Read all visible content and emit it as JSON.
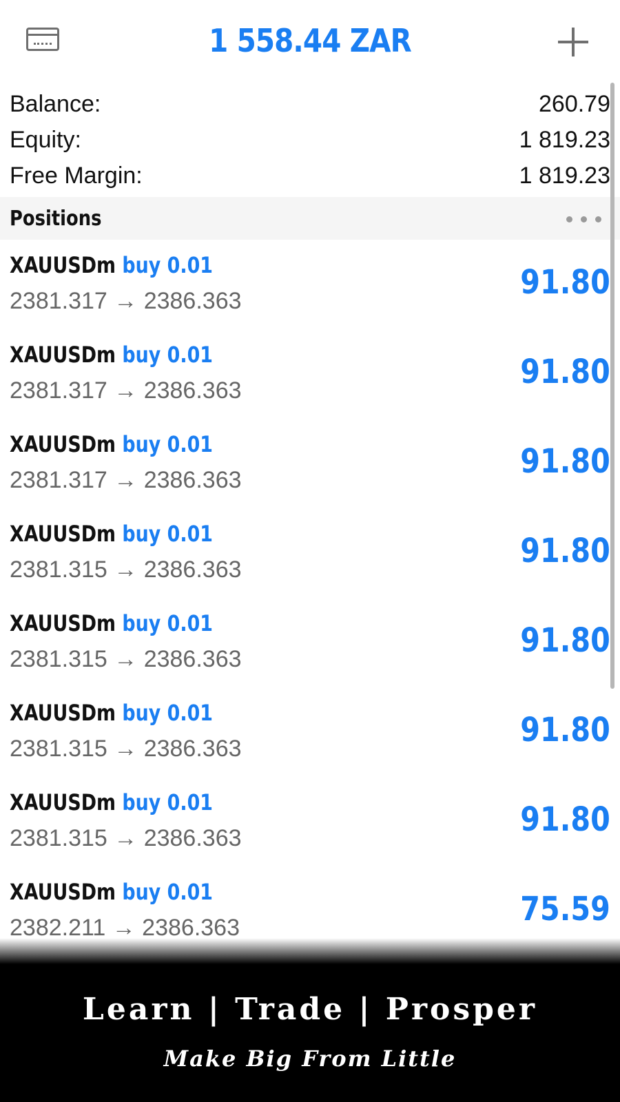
{
  "header": {
    "left_icon": "card-icon",
    "title": "1 558.44 ZAR",
    "right_icon": "plus-icon"
  },
  "summary": [
    {
      "label": "Balance:",
      "value": "260.79"
    },
    {
      "label": "Equity:",
      "value": "1 819.23"
    },
    {
      "label": "Free Margin:",
      "value": "1 819.23"
    }
  ],
  "positions_section": {
    "title": "Positions",
    "more_icon": "more-dots-icon"
  },
  "positions": [
    {
      "symbol": "XAUUSDm",
      "side": "buy 0.01",
      "prices": "2381.317 → 2386.363",
      "profit": "91.80"
    },
    {
      "symbol": "XAUUSDm",
      "side": "buy 0.01",
      "prices": "2381.317 → 2386.363",
      "profit": "91.80"
    },
    {
      "symbol": "XAUUSDm",
      "side": "buy 0.01",
      "prices": "2381.317 → 2386.363",
      "profit": "91.80"
    },
    {
      "symbol": "XAUUSDm",
      "side": "buy 0.01",
      "prices": "2381.315 → 2386.363",
      "profit": "91.80"
    },
    {
      "symbol": "XAUUSDm",
      "side": "buy 0.01",
      "prices": "2381.315 → 2386.363",
      "profit": "91.80"
    },
    {
      "symbol": "XAUUSDm",
      "side": "buy 0.01",
      "prices": "2381.315 → 2386.363",
      "profit": "91.80"
    },
    {
      "symbol": "XAUUSDm",
      "side": "buy 0.01",
      "prices": "2381.315 → 2386.363",
      "profit": "91.80"
    },
    {
      "symbol": "XAUUSDm",
      "side": "buy 0.01",
      "prices": "2382.211 → 2386.363",
      "profit": "75.59"
    }
  ],
  "banner": {
    "tagline": "Learn | Trade | Prosper",
    "subtitle": "Make Big From Little"
  },
  "colors": {
    "accent": "#1a7ef2",
    "text": "#111111",
    "muted": "#666666",
    "section_bg": "#f5f5f5",
    "banner_bg": "#000000"
  }
}
